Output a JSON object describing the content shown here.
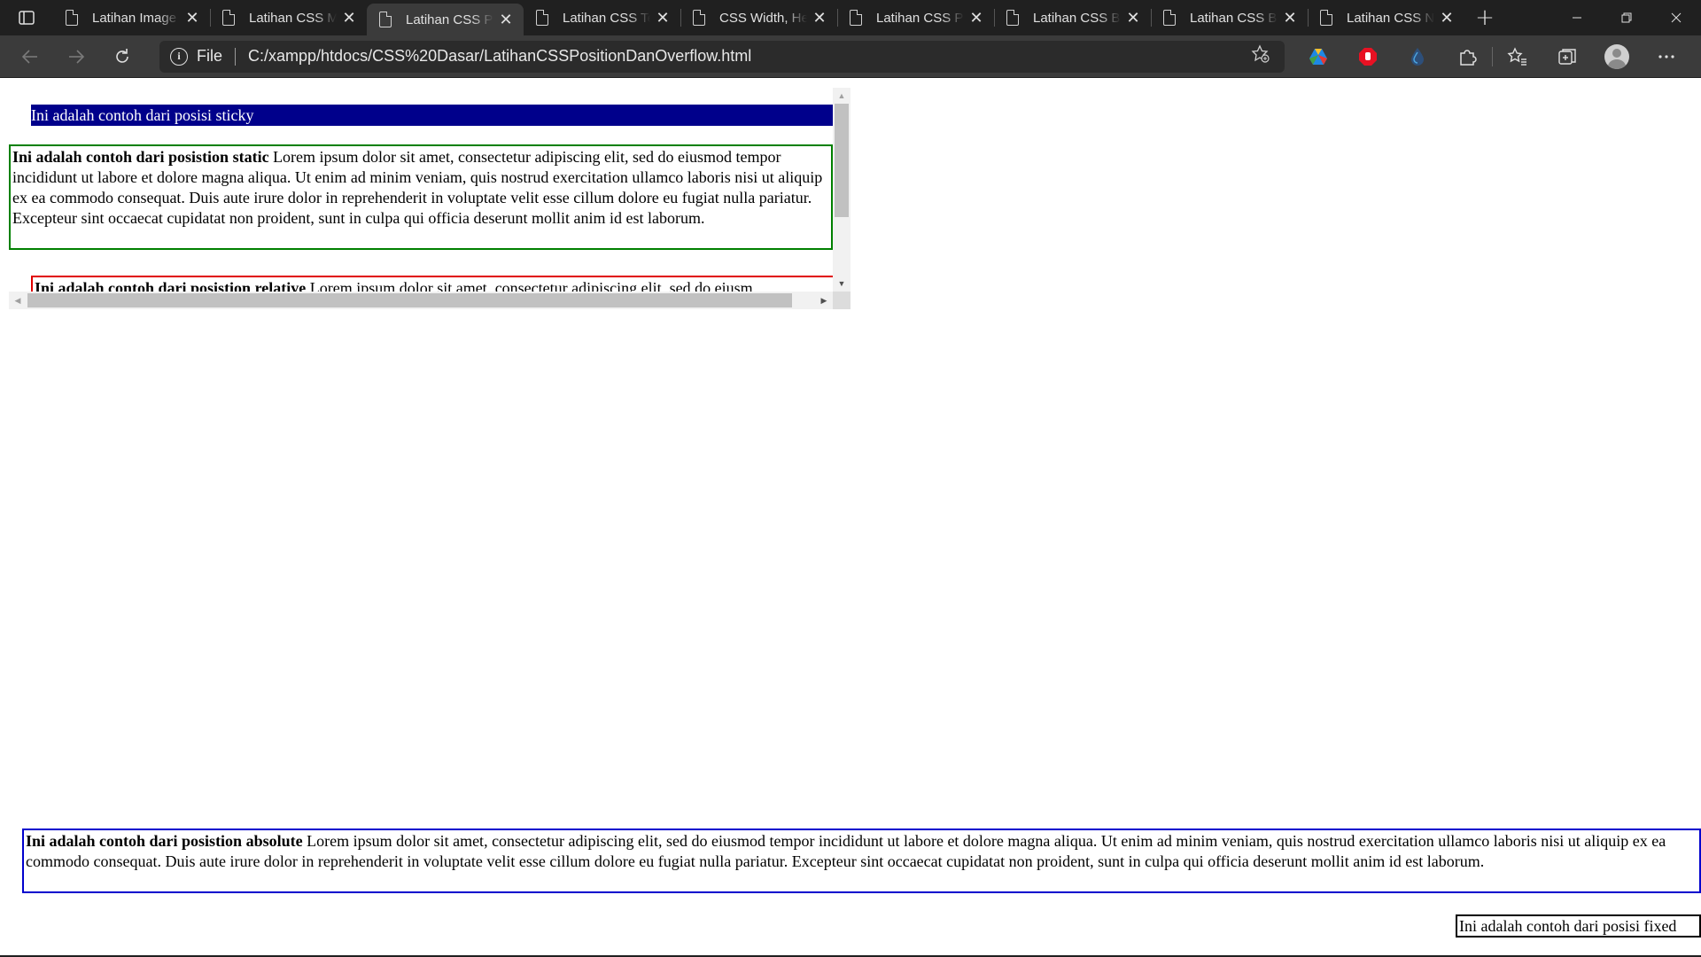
{
  "browser": {
    "tabs": [
      {
        "title": "Latihan Image",
        "active": false
      },
      {
        "title": "Latihan CSS M",
        "active": false
      },
      {
        "title": "Latihan CSS Po",
        "active": true
      },
      {
        "title": "Latihan CSS Te",
        "active": false
      },
      {
        "title": "CSS Width, He",
        "active": false
      },
      {
        "title": "Latihan CSS Po",
        "active": false
      },
      {
        "title": "Latihan CSS Bo",
        "active": false
      },
      {
        "title": "Latihan CSS Bo",
        "active": false
      },
      {
        "title": "Latihan CSS N",
        "active": false
      }
    ],
    "address": {
      "scheme_label": "File",
      "url": "C:/xampp/htdocs/CSS%20Dasar/LatihanCSSPositionDanOverflow.html"
    },
    "icons": {
      "tab_actions": "tab-actions-icon",
      "tab_page": "page-icon",
      "tab_close": "close-icon",
      "new_tab": "plus-icon",
      "back": "back-arrow-icon",
      "forward": "forward-arrow-icon",
      "refresh": "refresh-icon",
      "site_info": "info-icon",
      "add_favorite": "add-favorite-icon",
      "extensions": "puzzle-icon",
      "favorites": "favorites-icon",
      "collections": "collections-icon",
      "profile": "avatar",
      "menu": "more-icon"
    },
    "colors": {
      "tab_strip": "#202020",
      "toolbar": "#3b3b3b",
      "address_bg": "#2b2b2b"
    }
  },
  "page": {
    "sticky_text": "Ini adalah contoh dari posisi sticky",
    "static": {
      "label": "Ini adalah contoh dari posistion static",
      "body": " Lorem ipsum dolor sit amet, consectetur adipiscing elit, sed do eiusmod tempor incididunt ut labore et dolore magna aliqua. Ut enim ad minim veniam, quis nostrud exercitation ullamco laboris nisi ut aliquip ex ea commodo consequat. Duis aute irure dolor in reprehenderit in voluptate velit esse cillum dolore eu fugiat nulla pariatur. Excepteur sint occaecat cupidatat non proident, sunt in culpa qui officia deserunt mollit anim id est laborum."
    },
    "relative": {
      "label": "Ini adalah contoh dari posistion relative",
      "body": " Lorem ipsum dolor sit amet, consectetur adipiscing elit, sed do eiusm"
    },
    "absolute": {
      "label": "Ini adalah contoh dari posistion absolute",
      "body": " Lorem ipsum dolor sit amet, consectetur adipiscing elit, sed do eiusmod tempor incididunt ut labore et dolore magna aliqua. Ut enim ad minim veniam, quis nostrud exercitation ullamco laboris nisi ut aliquip ex ea commodo consequat. Duis aute irure dolor in reprehenderit in voluptate velit esse cillum dolore eu fugiat nulla pariatur. Excepteur sint occaecat cupidatat non proident, sunt in culpa qui officia deserunt mollit anim id est laborum."
    },
    "fixed_text": "Ini adalah contoh dari posisi fixed",
    "colors": {
      "sticky_bg": "#00008b",
      "static_border": "#008000",
      "relative_border": "#e00000",
      "absolute_border": "#0000cd",
      "fixed_border": "#000000"
    }
  }
}
